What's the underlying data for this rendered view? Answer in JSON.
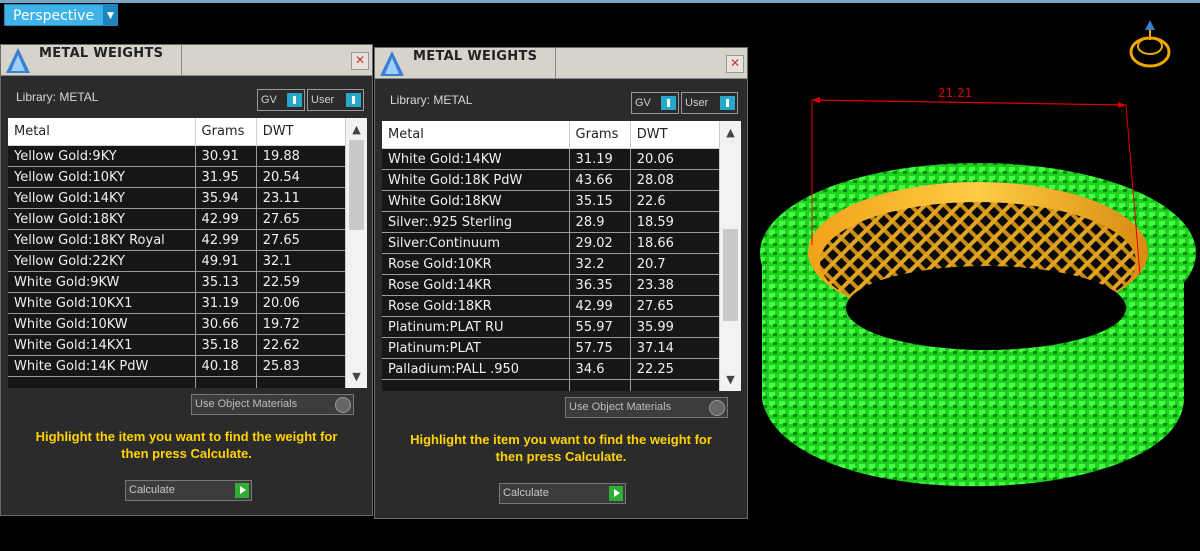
{
  "viewport": {
    "view_label": "Perspective",
    "dimension_label": "21.21"
  },
  "panels": [
    {
      "title": "METAL WEIGHTS",
      "library_label": "Library: METAL",
      "toggle_gv": "GV",
      "toggle_user": "User",
      "columns": [
        "Metal",
        "Grams",
        "DWT"
      ],
      "rows": [
        [
          "Yellow Gold:9KY",
          "30.91",
          "19.88"
        ],
        [
          "Yellow Gold:10KY",
          "31.95",
          "20.54"
        ],
        [
          "Yellow Gold:14KY",
          "35.94",
          "23.11"
        ],
        [
          "Yellow Gold:18KY",
          "42.99",
          "27.65"
        ],
        [
          "Yellow Gold:18KY Royal",
          "42.99",
          "27.65"
        ],
        [
          "Yellow Gold:22KY",
          "49.91",
          "32.1"
        ],
        [
          "White Gold:9KW",
          "35.13",
          "22.59"
        ],
        [
          "White Gold:10KX1",
          "31.19",
          "20.06"
        ],
        [
          "White Gold:10KW",
          "30.66",
          "19.72"
        ],
        [
          "White Gold:14KX1",
          "35.18",
          "22.62"
        ],
        [
          "White Gold:14K PdW",
          "40.18",
          "25.83"
        ]
      ],
      "use_object_materials": "Use Object Materials",
      "hint": "Highlight the item you want to find the weight for then press Calculate.",
      "calculate_label": "Calculate"
    },
    {
      "title": "METAL WEIGHTS",
      "library_label": "Library: METAL",
      "toggle_gv": "GV",
      "toggle_user": "User",
      "columns": [
        "Metal",
        "Grams",
        "DWT"
      ],
      "rows": [
        [
          "White Gold:14KW",
          "31.19",
          "20.06"
        ],
        [
          "White Gold:18K PdW",
          "43.66",
          "28.08"
        ],
        [
          "White Gold:18KW",
          "35.15",
          "22.6"
        ],
        [
          "Silver:.925 Sterling",
          "28.9",
          "18.59"
        ],
        [
          "Silver:Continuum",
          "29.02",
          "18.66"
        ],
        [
          "Rose Gold:10KR",
          "32.2",
          "20.7"
        ],
        [
          "Rose Gold:14KR",
          "36.35",
          "23.38"
        ],
        [
          "Rose Gold:18KR",
          "42.99",
          "27.65"
        ],
        [
          "Platinum:PLAT RU",
          "55.97",
          "35.99"
        ],
        [
          "Platinum:PLAT",
          "57.75",
          "37.14"
        ],
        [
          "Palladium:PALL .950",
          "34.6",
          "22.25"
        ]
      ],
      "use_object_materials": "Use Object Materials",
      "hint": "Highlight the item you want to find the weight for then press Calculate.",
      "calculate_label": "Calculate"
    }
  ]
}
